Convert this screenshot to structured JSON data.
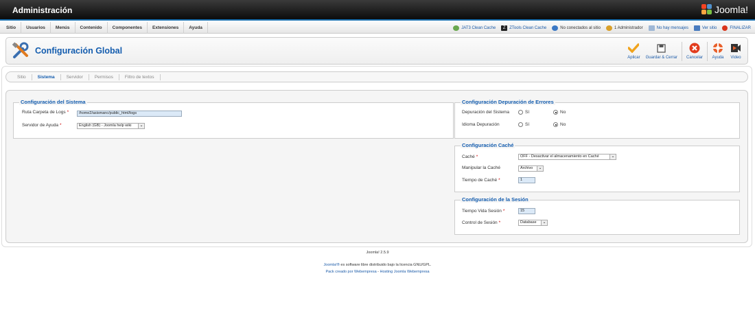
{
  "header": {
    "title": "Administración",
    "logo_text": "Joomla!"
  },
  "menu": {
    "items": [
      "Sitio",
      "Usuarios",
      "Menús",
      "Contenido",
      "Componentes",
      "Extensiones",
      "Ayuda"
    ]
  },
  "status": {
    "jat3": "JAT3 Clean Cache",
    "ztools": "ZTools Clean Cache",
    "visitors": "No conectados al sitio",
    "admins": "1 Administrador",
    "messages": "No hay mensajes",
    "view_site": "Ver sitio",
    "logout": "FINALIZAR"
  },
  "toolbar": {
    "title": "Configuración Global",
    "buttons": {
      "apply": "Aplicar",
      "save_close": "Guardar & Cerrar",
      "cancel": "Cancelar",
      "help": "Ayuda",
      "video": "Video"
    }
  },
  "tabs": [
    "Sitio",
    "Sistema",
    "Servidor",
    "Permisos",
    "Filtro de textos"
  ],
  "system": {
    "legend": "Configuración del Sistema",
    "log_label": "Ruta Carpeta de Logs",
    "log_value": "/home2/asismanc/public_html/logs",
    "help_label": "Servidor de Ayuda",
    "help_value": "English (GB) - Joomla help wiki"
  },
  "debug": {
    "legend": "Configuración Depuración de Errores",
    "system_label": "Depuración del Sistema",
    "lang_label": "Idioma Depuración",
    "yes": "Sí",
    "no": "No"
  },
  "cache": {
    "legend": "Configuración Caché",
    "cache_label": "Caché",
    "cache_value": "OFF - Desactivar el almacenamiento en Caché",
    "handler_label": "Manipular la Caché",
    "handler_value": "Archivo",
    "time_label": "Tiempo de Caché",
    "time_value": "1"
  },
  "session": {
    "legend": "Configuración de la Sesión",
    "life_label": "Tiempo Vida Sesión",
    "life_value": "15",
    "control_label": "Control de Sesión",
    "control_value": "Database"
  },
  "footer": {
    "version": "Joomla! 2.5.9",
    "joomla_link": "Joomla!®",
    "license": " es software libre distribuido bajo la licencia GNU/GPL.",
    "pack": "Pack creado por Webempresa",
    "sep": " - ",
    "hosting": "Hosting Joomla Webempresa"
  }
}
